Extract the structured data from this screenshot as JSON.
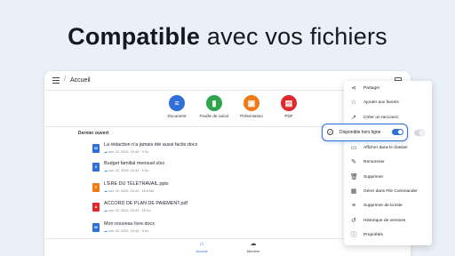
{
  "headline": {
    "bold": "Compatible",
    "rest": " avec vos fichiers"
  },
  "topbar": {
    "title": "Accueil",
    "separator": "/"
  },
  "actions": [
    {
      "label": "Document",
      "icon": "document-icon",
      "color": "#2f6fd8",
      "glyph": "≡"
    },
    {
      "label": "Feuille de calcul",
      "icon": "spreadsheet-icon",
      "color": "#2ea44f",
      "glyph": "▮"
    },
    {
      "label": "Présentation",
      "icon": "presentation-icon",
      "color": "#f07a18",
      "glyph": "▣"
    },
    {
      "label": "PDF",
      "icon": "pdf-icon",
      "color": "#e0282e",
      "glyph": "▤"
    }
  ],
  "recent": {
    "title": "Dernier ouvert",
    "files": [
      {
        "name": "La rédaction n'a jamais été aussi facile.docx",
        "meta": "nov. 22, 2024, 10:43 · 9 Ko",
        "type": "docx",
        "color": "#2f6fd8"
      },
      {
        "name": "Budget familial mensuel.xlsx",
        "meta": "nov. 22, 2024, 10:43 · 9 Ko",
        "type": "xlsx",
        "color": "#2f6fd8"
      },
      {
        "name": "L'ÈRE DU TÉLÉTRAVAIL.pptx",
        "meta": "nov. 22, 2024, 10:43 · 18.6 Mo",
        "type": "pptx",
        "color": "#f07a18"
      },
      {
        "name": "ACCORD DE PLAN DE PAIEMENT.pdf",
        "meta": "nov. 22, 2024, 10:43 · 15 Ko",
        "type": "pdf",
        "color": "#e0282e"
      },
      {
        "name": "Mon nouveau livre.docx",
        "meta": "nov. 22, 2024, 10:43 · 9 Ko",
        "type": "docx",
        "color": "#2f6fd8"
      }
    ]
  },
  "bottomnav": [
    {
      "label": "Accueil",
      "icon": "home-icon",
      "active": true
    },
    {
      "label": "Membre",
      "icon": "cloud-icon",
      "active": false
    }
  ],
  "context_menu": [
    {
      "label": "Partager",
      "icon": "share-icon",
      "glyph": "⋖"
    },
    {
      "label": "Ajouter aux favoris",
      "icon": "star-icon",
      "glyph": "☆"
    },
    {
      "label": "Créer un raccourci",
      "icon": "shortcut-icon",
      "glyph": "↗"
    },
    {
      "label": "Afficher dans le dossier",
      "icon": "folder-icon",
      "glyph": "▭"
    },
    {
      "label": "Renommer",
      "icon": "rename-icon",
      "glyph": "✎"
    },
    {
      "label": "Supprimer",
      "icon": "trash-icon",
      "glyph": "🗑"
    },
    {
      "label": "Gérer dans File Commander",
      "icon": "file-commander-icon",
      "glyph": "▦"
    },
    {
      "label": "Supprimer de la liste",
      "icon": "remove-from-list-icon",
      "glyph": "≡"
    },
    {
      "label": "Historique de versions",
      "icon": "history-icon",
      "glyph": "↺"
    },
    {
      "label": "Propriétés",
      "icon": "info-icon",
      "glyph": "ⓘ"
    }
  ],
  "offline": {
    "label": "Disponible hors ligne",
    "enabled": true,
    "accent": "#2f6fd8"
  }
}
